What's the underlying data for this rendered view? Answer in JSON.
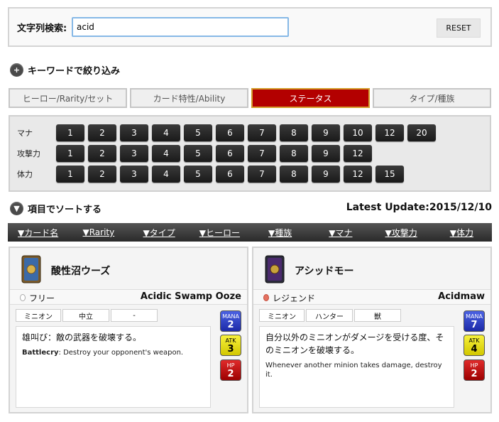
{
  "search": {
    "label": "文字列検索:",
    "value": "acid",
    "reset_label": "RESET"
  },
  "keyword_section": {
    "icon": "plus-icon",
    "title": "キーワードで絞り込み"
  },
  "tabs": [
    {
      "label": "ヒーロー/Rarity/セット",
      "active": false
    },
    {
      "label": "カード特性/Ability",
      "active": false
    },
    {
      "label": "ステータス",
      "active": true
    },
    {
      "label": "タイプ/種族",
      "active": false
    }
  ],
  "status_filters": [
    {
      "label": "マナ",
      "values": [
        "1",
        "2",
        "3",
        "4",
        "5",
        "6",
        "7",
        "8",
        "9",
        "10",
        "12",
        "20"
      ]
    },
    {
      "label": "攻撃力",
      "values": [
        "1",
        "2",
        "3",
        "4",
        "5",
        "6",
        "7",
        "8",
        "9",
        "12"
      ]
    },
    {
      "label": "体力",
      "values": [
        "1",
        "2",
        "3",
        "4",
        "5",
        "6",
        "7",
        "8",
        "9",
        "12",
        "15"
      ]
    }
  ],
  "sort_section": {
    "icon": "chevron-down-icon",
    "title": "項目でソートする",
    "latest_update": "Latest Update:2015/12/10"
  },
  "sort_bar": [
    "▼カード名",
    "▼Rarity",
    "▼タイプ",
    "▼ヒーロー",
    "▼種族",
    "▼マナ",
    "▼攻撃力",
    "▼体力"
  ],
  "cards": [
    {
      "name": "酸性沼ウーズ",
      "rarity": "フリー",
      "english_name": "Acidic Swamp Ooze",
      "type": "ミニオン",
      "hero": "中立",
      "tribe": "-",
      "text_jp": "雄叫び：敵の武器を破壊する。",
      "text_en_bold": "Battlecry",
      "text_en": ": Destroy your opponent's weapon.",
      "mana_label": "MANA",
      "mana": "2",
      "atk_label": "ATK",
      "atk": "3",
      "hp_label": "HP",
      "hp": "2",
      "thumb_color": "#3b6aa8"
    },
    {
      "name": "アシッドモー",
      "rarity": "レジェンド",
      "english_name": "Acidmaw",
      "type": "ミニオン",
      "hero": "ハンター",
      "tribe": "獣",
      "text_jp": "自分以外のミニオンがダメージを受ける度、そのミニオンを破壊する。",
      "text_en_bold": "",
      "text_en": "Whenever another minion takes damage, destroy it.",
      "mana_label": "MANA",
      "mana": "7",
      "atk_label": "ATK",
      "atk": "4",
      "hp_label": "HP",
      "hp": "2",
      "thumb_color": "#4b2a6e"
    }
  ]
}
